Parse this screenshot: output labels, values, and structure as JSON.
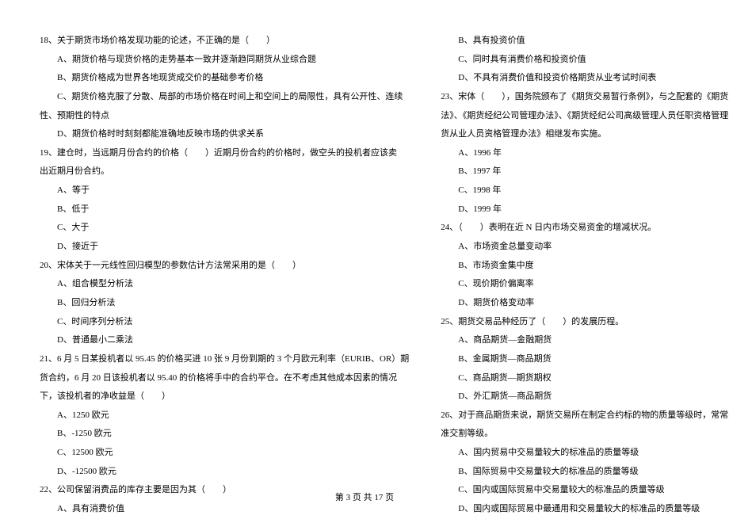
{
  "left": {
    "q18": {
      "stem": "18、关于期货市场价格发现功能的论述，不正确的是（　　）",
      "a": "A、期货价格与现货价格的走势基本一致并逐渐趋同期货从业综合题",
      "b": "B、期货价格成为世界各地现货成交价的基础参考价格",
      "c": "C、期货价格克服了分散、局部的市场价格在时间上和空间上的局限性，具有公开性、连续",
      "c2": "性、预期性的特点",
      "d": "D、期货价格时时刻刻都能准确地反映市场的供求关系"
    },
    "q19": {
      "stem1": "19、建仓时，当远期月份合约的价格（　　）近期月份合约的价格时，做空头的投机者应该卖",
      "stem2": "出近期月份合约。",
      "a": "A、等于",
      "b": "B、低于",
      "c": "C、大于",
      "d": "D、接近于"
    },
    "q20": {
      "stem": "20、宋体关于一元线性回归模型的参数估计方法常采用的是（　　）",
      "a": "A、组合模型分析法",
      "b": "B、回归分析法",
      "c": "C、时间序列分析法",
      "d": "D、普通最小二乘法"
    },
    "q21": {
      "stem1": "21、6 月 5 日某投机者以 95.45 的价格买进 10 张 9 月份到期的 3 个月欧元利率（EURIB、OR）期",
      "stem2": "货合约，6 月 20 日该投机者以 95.40 的价格将手中的合约平仓。在不考虑其他成本因素的情况",
      "stem3": "下，该投机者的净收益是（　　）",
      "a": "A、1250 欧元",
      "b": "B、-1250 欧元",
      "c": "C、12500 欧元",
      "d": "D、-12500 欧元"
    },
    "q22": {
      "stem": "22、公司保留消费品的库存主要是因为其（　　）",
      "a": "A、具有消费价值"
    }
  },
  "right": {
    "q22r": {
      "b": "B、具有投资价值",
      "c": "C、同时具有消费价格和投资价值",
      "d": "D、不具有消费价值和投资价格期货从业考试时间表"
    },
    "q23": {
      "stem1": "23、宋体（　　），国务院颁布了《期货交易暂行条例》，与之配套的《期货交易所管理办",
      "stem2": "法》、《期货经纪公司管理办法》、《期货经纪公司高级管理人员任职资格管理办法》和《期",
      "stem3": "货从业人员资格管理办法》相继发布实施。",
      "a": "A、1996 年",
      "b": "B、1997 年",
      "c": "C、1998 年",
      "d": "D、1999 年"
    },
    "q24": {
      "stem": "24、（　　）表明在近 N 日内市场交易资金的增减状况。",
      "a": "A、市场资金总量变动率",
      "b": "B、市场资金集中度",
      "c": "C、现价期价偏离率",
      "d": "D、期货价格变动率"
    },
    "q25": {
      "stem": "25、期货交易品种经历了（　　）的发展历程。",
      "a": "A、商品期货—金融期货",
      "b": "B、金属期货—商品期货",
      "c": "C、商品期货—期货期权",
      "d": "D、外汇期货—商品期货"
    },
    "q26": {
      "stem1": "26、对于商品期货来说，期货交易所在制定合约标的物的质量等级时，常常采用（　　）为标",
      "stem2": "准交割等级。",
      "a": "A、国内贸易中交易量较大的标准品的质量等级",
      "b": "B、国际贸易中交易量较大的标准品的质量等级",
      "c": "C、国内或国际贸易中交易量较大的标准品的质量等级",
      "d": "D、国内或国际贸易中最通用和交易量较大的标准品的质量等级"
    }
  },
  "footer": "第 3 页 共 17 页"
}
